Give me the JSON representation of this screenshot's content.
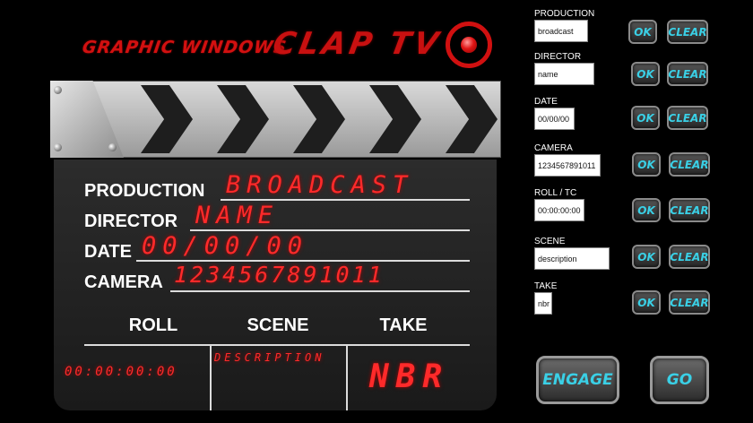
{
  "header": {
    "brand": "GRAPHIC WINDOWS",
    "app_title": "CLAP TV"
  },
  "slate": {
    "production": {
      "label": "PRODUCTION",
      "value": "BROADCAST"
    },
    "director": {
      "label": "DIRECTOR",
      "value": "NAME"
    },
    "date": {
      "label": "DATE",
      "value": "00/00/00"
    },
    "camera": {
      "label": "CAMERA",
      "value": "1234567891011"
    },
    "roll": {
      "label": "ROLL",
      "value": "00:00:00:00"
    },
    "scene": {
      "label": "SCENE",
      "value": "DESCRIPTION"
    },
    "take": {
      "label": "TAKE",
      "value": "NBR"
    }
  },
  "panel": {
    "fields": [
      {
        "label": "PRODUCTION",
        "value": "broadcast"
      },
      {
        "label": "DIRECTOR",
        "value": "name"
      },
      {
        "label": "DATE",
        "value": "00/00/00"
      },
      {
        "label": "CAMERA",
        "value": "1234567891011"
      },
      {
        "label": "ROLL / TC",
        "value": "00:00:00:00"
      },
      {
        "label": "SCENE",
        "value": "description"
      },
      {
        "label": "TAKE",
        "value": "nbr"
      }
    ],
    "ok_label": "OK",
    "clear_label": "CLEAR",
    "engage_label": "ENGAGE",
    "go_label": "GO"
  },
  "colors": {
    "led_red": "#ff2a2a",
    "button_text": "#3ad0e6",
    "background": "#000000"
  }
}
